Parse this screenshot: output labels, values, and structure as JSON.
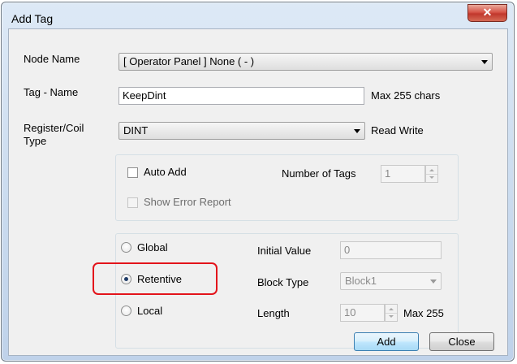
{
  "window": {
    "title": "Add Tag",
    "close_glyph": "✕"
  },
  "node_name": {
    "label": "Node Name",
    "value": "[ Operator Panel ] None ( - )"
  },
  "tag_name": {
    "label": "Tag - Name",
    "value": "KeepDint",
    "hint": "Max 255 chars"
  },
  "register": {
    "label_line1": "Register/Coil",
    "label_line2": "Type",
    "value": "DINT",
    "access": "Read Write"
  },
  "auto_group": {
    "auto_add_label": "Auto Add",
    "auto_add_checked": false,
    "number_of_tags_label": "Number of Tags",
    "number_of_tags_value": "1",
    "show_error_label": "Show Error Report",
    "show_error_checked": false
  },
  "scope": {
    "options": [
      {
        "label": "Global",
        "selected": false
      },
      {
        "label": "Retentive",
        "selected": true
      },
      {
        "label": "Local",
        "selected": false
      }
    ],
    "initial_value_label": "Initial Value",
    "initial_value": "0",
    "block_type_label": "Block Type",
    "block_type_value": "Block1",
    "length_label": "Length",
    "length_value": "10",
    "length_max": "Max 255"
  },
  "buttons": {
    "add": "Add",
    "close": "Close"
  },
  "colors": {
    "highlight": "#e3141b",
    "default_button_border": "#3c7fb1"
  }
}
